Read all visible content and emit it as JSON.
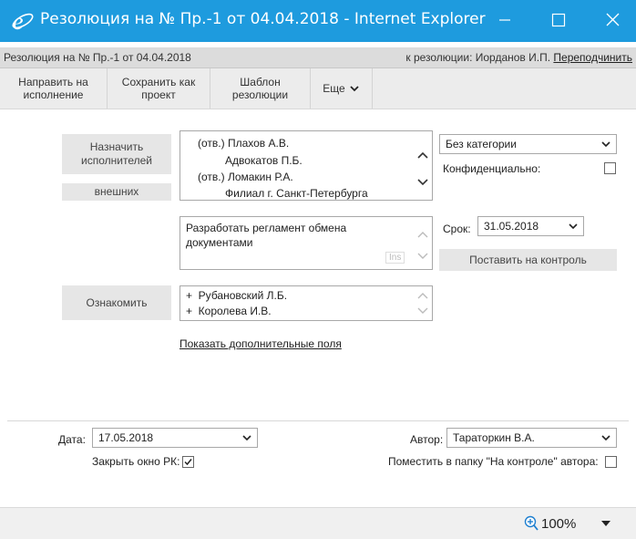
{
  "window": {
    "title": "Резолюция на № Пр.-1 от 04.04.2018 - Internet Explorer",
    "minimize_symbol": "—",
    "maximize_symbol": "☐",
    "close_symbol": "✕"
  },
  "infobar": {
    "left": "Резолюция на № Пр.-1 от 04.04.2018",
    "right_prefix": "к резолюции: Иорданов И.П.",
    "right_link": "Переподчинить"
  },
  "toolbar": {
    "send": "Направить на исполнение",
    "save_draft": "Сохранить как проект",
    "template": "Шаблон резолюции",
    "more": "Еще"
  },
  "form": {
    "assign_button": "Назначить исполнителей",
    "external_button": "внешних",
    "executors": [
      {
        "text": "(отв.) Плахов А.В."
      },
      {
        "text": "Адвокатов П.Б."
      },
      {
        "text": "(отв.) Ломакин Р.А."
      },
      {
        "text": "Филиал г. Санкт-Петербурга"
      }
    ],
    "category": "Без категории",
    "confidential_label": "Конфиденциально:",
    "task_text": "Разработать регламент обмена документами",
    "ins_label": "Ins",
    "deadline_label": "Срок:",
    "deadline_value": "31.05.2018",
    "control_button": "Поставить на контроль",
    "acquaint_button": "Ознакомить",
    "acquaint_list": [
      {
        "text": "+  Рубановский Л.Б."
      },
      {
        "text": "+  Королева И.В."
      }
    ],
    "show_more_link": "Показать дополнительные поля",
    "date_label": "Дата:",
    "date_value": "17.05.2018",
    "close_rk_label": "Закрыть окно РК:",
    "close_rk_checked": true,
    "author_label": "Автор:",
    "author_value": "Тараторкин В.А.",
    "folder_label": "Поместить в папку \"На контроле\" автора:",
    "folder_checked": false
  },
  "statusbar": {
    "zoom": "100%"
  },
  "icons": {
    "browser": "internet-explorer-icon",
    "zoom": "zoom-in-icon"
  },
  "colors": {
    "titlebar": "#1e9bde",
    "infobar": "#dcdcdc",
    "button": "#e6e6e6"
  }
}
